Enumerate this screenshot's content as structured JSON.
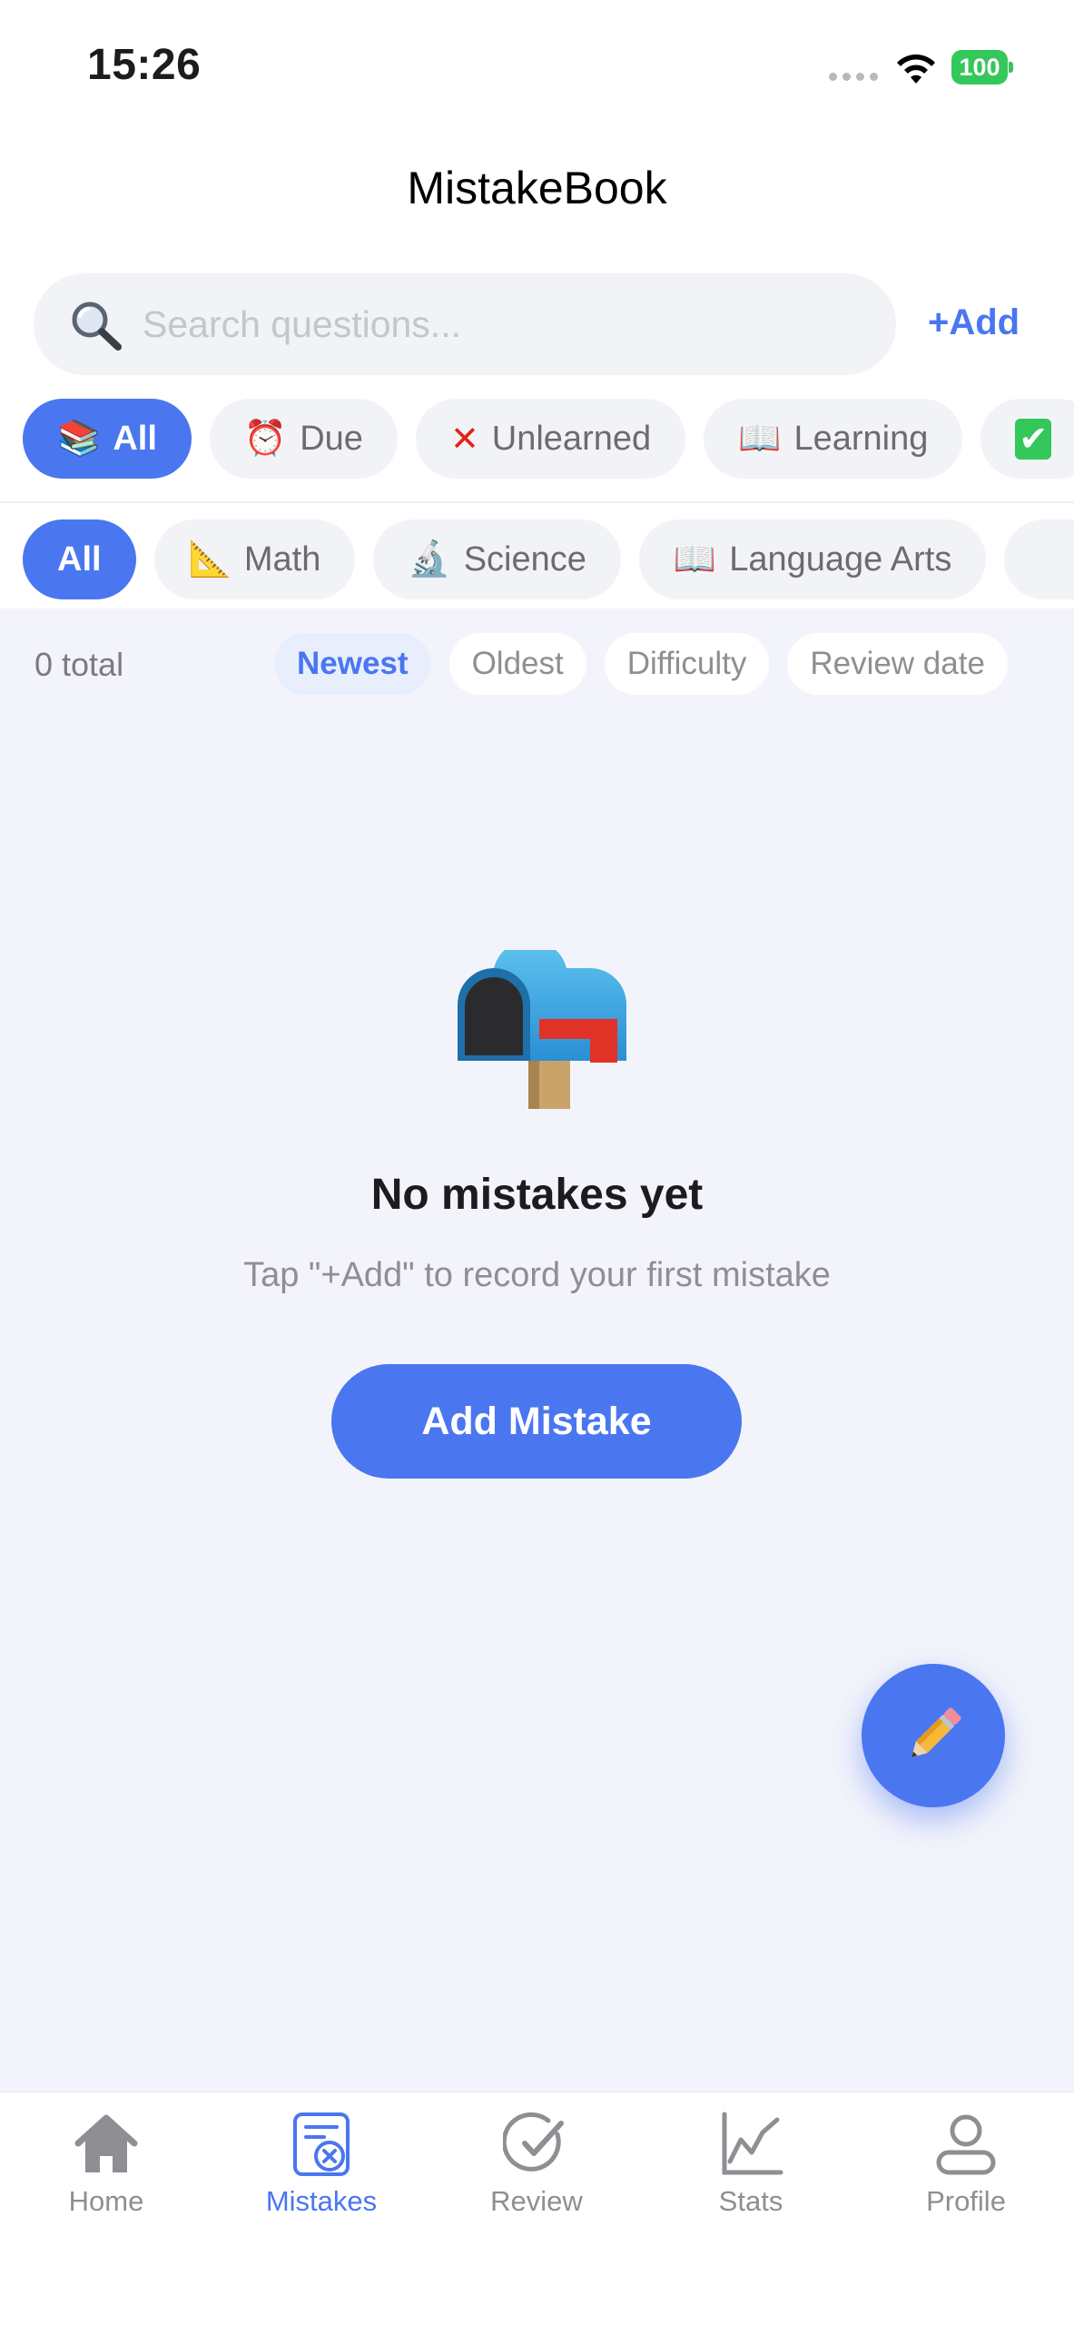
{
  "status_bar": {
    "time": "15:26",
    "battery": "100"
  },
  "nav": {
    "title": "MistakeBook"
  },
  "search": {
    "placeholder": "Search questions...",
    "value": ""
  },
  "add_link": "+Add",
  "status_filters": [
    {
      "icon": "books-icon",
      "label": "All",
      "active": true
    },
    {
      "icon": "alarm-clock-icon",
      "label": "Due",
      "active": false
    },
    {
      "icon": "cross-mark-icon",
      "label": "Unlearned",
      "active": false
    },
    {
      "icon": "open-book-icon",
      "label": "Learning",
      "active": false
    },
    {
      "icon": "check-mark-icon",
      "label": "",
      "active": false
    }
  ],
  "subject_filters": [
    {
      "icon": "",
      "label": "All",
      "active": true
    },
    {
      "icon": "triangle-ruler-icon",
      "label": "Math",
      "active": false
    },
    {
      "icon": "microscope-icon",
      "label": "Science",
      "active": false
    },
    {
      "icon": "open-book-icon",
      "label": "Language Arts",
      "active": false
    }
  ],
  "list": {
    "total": "0 total",
    "sort_options": [
      "Newest",
      "Oldest",
      "Difficulty",
      "Review date"
    ],
    "active_sort": "Newest"
  },
  "empty_state": {
    "icon": "mailbox-icon",
    "title": "No mistakes yet",
    "subtitle": "Tap \"+Add\" to record your first mistake",
    "button_label": "Add Mistake"
  },
  "fab": {
    "icon": "pencil-icon"
  },
  "tabs": [
    {
      "label": "Home",
      "icon": "home-icon",
      "active": false
    },
    {
      "label": "Mistakes",
      "icon": "mistakes-icon",
      "active": true
    },
    {
      "label": "Review",
      "icon": "review-check-icon",
      "active": false
    },
    {
      "label": "Stats",
      "icon": "stats-chart-icon",
      "active": false
    },
    {
      "label": "Profile",
      "icon": "profile-icon",
      "active": false
    }
  ],
  "colors": {
    "accent": "#4a76f0",
    "background": "#f3f4fb",
    "battery": "#34c759"
  }
}
